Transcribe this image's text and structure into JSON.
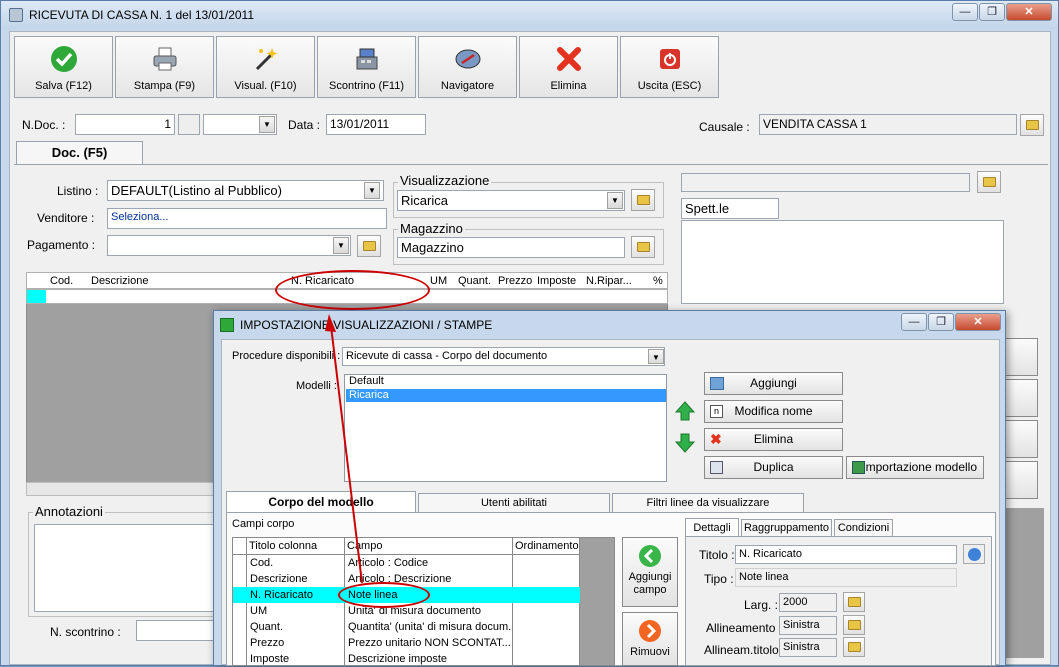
{
  "window": {
    "title": "RICEVUTA DI CASSA N. 1  del 13/01/2011",
    "min": "—",
    "max": "❐",
    "close": "✕"
  },
  "toolbar": {
    "buttons": [
      {
        "label": "Salva (F12)",
        "icon": "checkmark-icon"
      },
      {
        "label": "Stampa (F9)",
        "icon": "printer-icon"
      },
      {
        "label": "Visual. (F10)",
        "icon": "magic-wand-icon"
      },
      {
        "label": "Scontrino (F11)",
        "icon": "cash-register-icon"
      },
      {
        "label": "Navigatore",
        "icon": "compass-icon"
      },
      {
        "label": "Elimina",
        "icon": "delete-x-icon"
      },
      {
        "label": "Uscita (ESC)",
        "icon": "exit-icon"
      }
    ]
  },
  "header": {
    "ndoc_label": "N.Doc. :",
    "ndoc_value": "1",
    "data_label": "Data :",
    "data_value": "13/01/2011",
    "causale_label": "Causale :",
    "causale_value": "VENDITA CASSA 1"
  },
  "tabs": {
    "doc": "Doc. (F5)"
  },
  "form": {
    "listino_label": "Listino :",
    "listino_value": "DEFAULT(Listino al Pubblico)",
    "venditore_label": "Venditore :",
    "venditore_value": "Seleziona...",
    "pagamento_label": "Pagamento :",
    "visualizzazione_title": "Visualizzazione",
    "visualizzazione_value": "Ricarica",
    "magazzino_title": "Magazzino",
    "magazzino_value": "Magazzino",
    "spett": "Spett.le",
    "annotazioni": "Annotazioni",
    "nscontrino_label": "N. scontrino :"
  },
  "grid": {
    "headers": [
      "Cod.",
      "Descrizione",
      "N. Ricaricato",
      "UM",
      "Quant.",
      "Prezzo",
      "Imposte",
      "N.Ripar...",
      "%"
    ]
  },
  "dialog": {
    "title": "IMPOSTAZIONE VISUALIZZAZIONI / STAMPE",
    "procedure_label": "Procedure disponibili :",
    "procedure_value": "Ricevute di cassa - Corpo del documento",
    "modelli_label": "Modelli :",
    "modelli": [
      "Default",
      "Ricarica"
    ],
    "buttons": {
      "aggiungi": "Aggiungi",
      "modifica": "Modifica nome",
      "elimina": "Elimina",
      "duplica": "Duplica",
      "importazione": "Importazione modello"
    },
    "tabs": [
      "Corpo del modello",
      "Utenti abilitati",
      "Filtri linee da visualizzare"
    ],
    "campi_label": "Campi corpo",
    "columns": [
      "Titolo colonna",
      "Campo",
      "Ordinamento"
    ],
    "rows": [
      {
        "titolo": "Cod.",
        "campo": "Articolo : Codice"
      },
      {
        "titolo": "Descrizione",
        "campo": "Articolo : Descrizione"
      },
      {
        "titolo": "N. Ricaricato",
        "campo": "Note linea"
      },
      {
        "titolo": "UM",
        "campo": "Unita' di misura documento"
      },
      {
        "titolo": "Quant.",
        "campo": "Quantita' (unita' di misura docum..."
      },
      {
        "titolo": "Prezzo",
        "campo": "Prezzo unitario NON SCONTAT..."
      },
      {
        "titolo": "Imposte",
        "campo": "Descrizione imposte"
      }
    ],
    "aggiungi_campo": "Aggiungi campo",
    "rimuovi": "Rimuovi",
    "subtabs": [
      "Dettagli",
      "Raggruppamento",
      "Condizioni"
    ],
    "titolo_label": "Titolo :",
    "titolo_value": "N. Ricaricato",
    "tipo_label": "Tipo :",
    "tipo_value": "Note linea",
    "larg_label": "Larg. :",
    "larg_value": "2000",
    "allineamento_label": "Allineamento :",
    "allineamento_value": "Sinistra",
    "allineam_titolo_label": "Allineam.titolo :",
    "allineam_titolo_value": "Sinistra"
  },
  "colors": {
    "highlight": "#3399ff",
    "cyan_row": "#00ffff",
    "annotation": "#cc0000"
  }
}
